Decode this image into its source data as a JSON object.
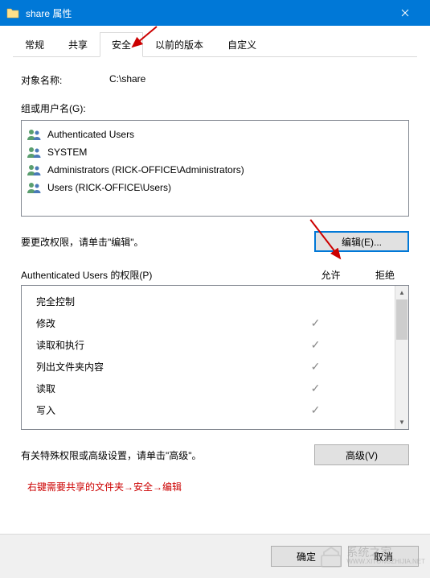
{
  "titlebar": {
    "title": "share 属性"
  },
  "tabs": [
    {
      "label": "常规"
    },
    {
      "label": "共享"
    },
    {
      "label": "安全",
      "active": true
    },
    {
      "label": "以前的版本"
    },
    {
      "label": "自定义"
    }
  ],
  "object": {
    "label": "对象名称:",
    "value": "C:\\share"
  },
  "groups": {
    "label": "组或用户名(G):",
    "items": [
      {
        "name": "Authenticated Users"
      },
      {
        "name": "SYSTEM"
      },
      {
        "name": "Administrators (RICK-OFFICE\\Administrators)"
      },
      {
        "name": "Users (RICK-OFFICE\\Users)"
      }
    ]
  },
  "edit": {
    "text": "要更改权限，请单击\"编辑\"。",
    "button": "编辑(E)..."
  },
  "permissions": {
    "header_name": "Authenticated Users 的权限(P)",
    "header_allow": "允许",
    "header_deny": "拒绝",
    "rows": [
      {
        "label": "完全控制",
        "allow": false
      },
      {
        "label": "修改",
        "allow": true
      },
      {
        "label": "读取和执行",
        "allow": true
      },
      {
        "label": "列出文件夹内容",
        "allow": true
      },
      {
        "label": "读取",
        "allow": true
      },
      {
        "label": "写入",
        "allow": true
      }
    ]
  },
  "advanced": {
    "text": "有关特殊权限或高级设置，请单击\"高级\"。",
    "button": "高级(V)"
  },
  "note": "右键需要共享的文件夹→安全→编辑",
  "footer": {
    "ok": "确定",
    "cancel": "取消"
  },
  "watermark": {
    "brand": "系统之家",
    "url": "WWW.XITONGZHIJIA.NET"
  }
}
